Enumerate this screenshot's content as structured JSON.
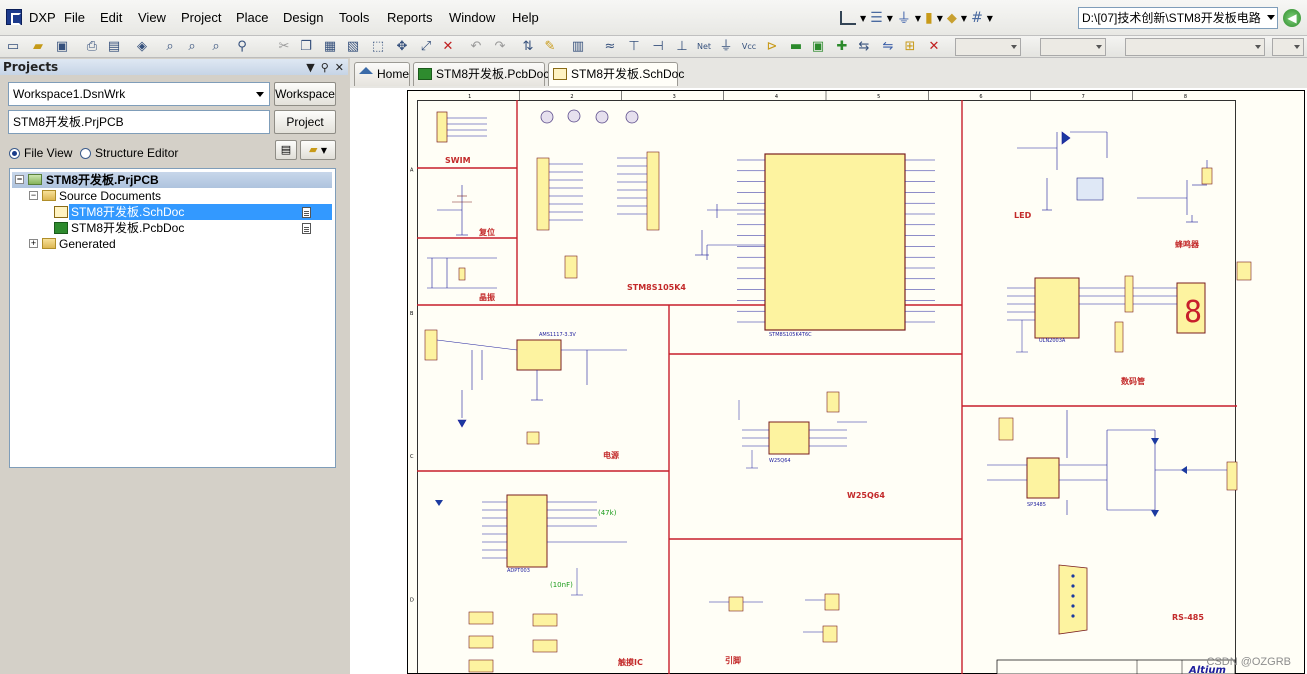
{
  "app": {
    "name": "DXP"
  },
  "menu": [
    "File",
    "Edit",
    "View",
    "Project",
    "Place",
    "Design",
    "Tools",
    "Reports",
    "Window",
    "Help"
  ],
  "path": "D:\\[07]技术创新\\STM8开发板电路",
  "projects_panel": {
    "title": "Projects",
    "workspace_value": "Workspace1.DsnWrk",
    "workspace_button": "Workspace",
    "project_value": "STM8开发板.PrjPCB",
    "project_button": "Project",
    "view_options": [
      "File View",
      "Structure Editor"
    ],
    "selected_view": "File View",
    "tree": {
      "root": "STM8开发板.PrjPCB",
      "folder": "Source Documents",
      "documents": [
        "STM8开发板.SchDoc",
        "STM8开发板.PcbDoc"
      ],
      "selected_document": "STM8开发板.SchDoc",
      "generated": "Generated"
    }
  },
  "tabs": [
    {
      "label": "Home",
      "icon": "home-icon"
    },
    {
      "label": "STM8开发板.PcbDoc",
      "icon": "pcb-doc-icon"
    },
    {
      "label": "STM8开发板.SchDoc",
      "icon": "sch-doc-icon",
      "active": true
    }
  ],
  "schematic": {
    "blocks": [
      "SWIM",
      "复位",
      "晶振",
      "STM8S105K4",
      "LED",
      "蜂鸣器",
      "数码管",
      "电源",
      "W25Q64",
      "RS-485",
      "触摸IC",
      "引脚"
    ],
    "border_letters": [
      "A",
      "B",
      "C",
      "D"
    ],
    "border_numbers": [
      "1",
      "2",
      "3",
      "4",
      "5",
      "6",
      "7",
      "8"
    ],
    "chip_labels": {
      "mcu": "STM8S105K4T6C",
      "ldo": "AMS1117-3.3V",
      "flash": "W25Q64",
      "touch": "ADPT003",
      "rs485": "SP3485",
      "seg_driver": "ULN2003A"
    },
    "notes": [
      "(47k)",
      "(10nF)"
    ],
    "title_block_brand": "Altium"
  },
  "watermark": "CSDN @OZGRB"
}
